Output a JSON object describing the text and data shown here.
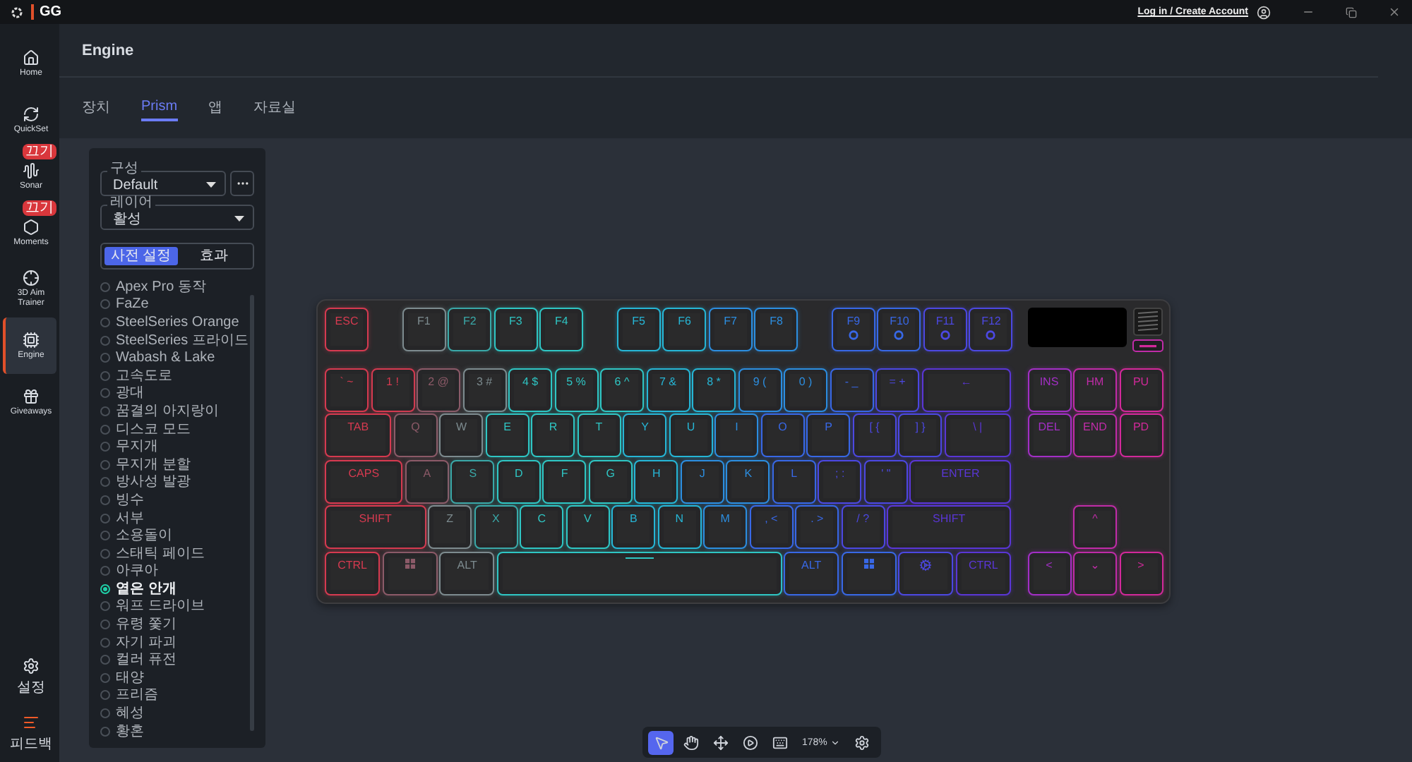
{
  "top_bar": {
    "logo": "GG",
    "account_link": "Log in / Create Account"
  },
  "sidebar": {
    "items": [
      {
        "kind": "home",
        "label": "Home",
        "selected": false
      },
      {
        "kind": "quickset",
        "label": "QuickSet",
        "selected": false
      },
      {
        "kind": "sonar",
        "label": "Sonar",
        "badge": "끄기",
        "selected": false
      },
      {
        "kind": "moments",
        "label": "Moments",
        "badge": "끄기",
        "selected": false
      },
      {
        "kind": "aim",
        "label": "3D Aim Trainer",
        "selected": false
      },
      {
        "kind": "engine",
        "label": "Engine",
        "selected": true
      },
      {
        "kind": "giveaways",
        "label": "Giveaways",
        "selected": false
      }
    ],
    "bottom_items": [
      {
        "kind": "settings",
        "label": "설정"
      },
      {
        "kind": "feedback",
        "label": "피드백"
      }
    ]
  },
  "page": {
    "title": "Engine",
    "tabs": [
      {
        "label": "장치",
        "selected": false
      },
      {
        "label": "Prism",
        "selected": true
      },
      {
        "label": "앱",
        "selected": false
      },
      {
        "label": "자료실",
        "selected": false
      }
    ]
  },
  "panel": {
    "config": {
      "label": "구성",
      "value": "Default"
    },
    "layer": {
      "label": "레이어",
      "value": "활성"
    },
    "modes": [
      {
        "label": "사전 설정",
        "selected": true
      },
      {
        "label": "효과",
        "selected": false
      }
    ],
    "presets": [
      {
        "label": "Apex Pro 동작",
        "selected": false
      },
      {
        "label": "FaZe",
        "selected": false
      },
      {
        "label": "SteelSeries Orange",
        "selected": false
      },
      {
        "label": "SteelSeries 프라이드",
        "selected": false
      },
      {
        "label": "Wabash & Lake",
        "selected": false
      },
      {
        "label": "고속도로",
        "selected": false
      },
      {
        "label": "광대",
        "selected": false
      },
      {
        "label": "꿈결의 아지랑이",
        "selected": false
      },
      {
        "label": "디스코 모드",
        "selected": false
      },
      {
        "label": "무지개",
        "selected": false
      },
      {
        "label": "무지개 분할",
        "selected": false
      },
      {
        "label": "방사성 발광",
        "selected": false
      },
      {
        "label": "빙수",
        "selected": false
      },
      {
        "label": "서부",
        "selected": false
      },
      {
        "label": "소용돌이",
        "selected": false
      },
      {
        "label": "스태틱 페이드",
        "selected": false
      },
      {
        "label": "아쿠아",
        "selected": false
      },
      {
        "label": "옅은 안개",
        "selected": true
      },
      {
        "label": "워프 드라이브",
        "selected": false
      },
      {
        "label": "유령 쫓기",
        "selected": false
      },
      {
        "label": "자기 파괴",
        "selected": false
      },
      {
        "label": "컬러 퓨전",
        "selected": false
      },
      {
        "label": "태양",
        "selected": false
      },
      {
        "label": "프리즘",
        "selected": false
      },
      {
        "label": "혜성",
        "selected": false
      },
      {
        "label": "황혼",
        "selected": false
      }
    ]
  },
  "keyboard": {
    "function_row": [
      [
        {
          "kind": "key",
          "label": "ESC",
          "color": "#d63a50"
        }
      ],
      [
        {
          "kind": "key",
          "label": "F1",
          "color": "#7d8b8f"
        },
        {
          "kind": "key",
          "label": "F2",
          "color": "#3aa8a8"
        },
        {
          "kind": "key",
          "label": "F3",
          "color": "#2fc6c4"
        },
        {
          "kind": "key",
          "label": "F4",
          "color": "#2fc6c4"
        }
      ],
      [
        {
          "kind": "key",
          "label": "F5",
          "color": "#26b6d6"
        },
        {
          "kind": "key",
          "label": "F6",
          "color": "#26b6d6"
        },
        {
          "kind": "key",
          "label": "F7",
          "color": "#2c8ee0"
        },
        {
          "kind": "key",
          "label": "F8",
          "color": "#2c8ee0"
        }
      ],
      [
        {
          "kind": "media",
          "label": "F9",
          "color": "#3868e6"
        },
        {
          "kind": "media",
          "label": "F10",
          "color": "#3868e6"
        },
        {
          "kind": "media",
          "label": "F11",
          "color": "#4c48e2"
        },
        {
          "kind": "media",
          "label": "F12",
          "color": "#4c48e2"
        }
      ]
    ],
    "main_rows": [
      [
        {
          "kind": "key",
          "label": "` ~",
          "color": "#d63a50"
        },
        {
          "kind": "key",
          "label": "1 !",
          "color": "#d63a50"
        },
        {
          "kind": "key",
          "label": "2 @",
          "color": "#8c5a68"
        },
        {
          "kind": "key",
          "label": "3 #",
          "color": "#7d8b8f"
        },
        {
          "kind": "key",
          "label": "4 $",
          "color": "#2fc6c4"
        },
        {
          "kind": "key",
          "label": "5 %",
          "color": "#2fc6c4"
        },
        {
          "kind": "key",
          "label": "6 ^",
          "color": "#2fc6c4"
        },
        {
          "kind": "key",
          "label": "7 &",
          "color": "#26b6d6"
        },
        {
          "kind": "key",
          "label": "8 *",
          "color": "#26b6d6"
        },
        {
          "kind": "key",
          "label": "9 (",
          "color": "#2c8ee0"
        },
        {
          "kind": "key",
          "label": "0 )",
          "color": "#2c8ee0"
        },
        {
          "kind": "key",
          "label": "- _",
          "color": "#3868e6"
        },
        {
          "kind": "key",
          "label": "= +",
          "color": "#4c48e2"
        },
        {
          "kind": "back",
          "label": "←",
          "color": "#5a36d6"
        }
      ],
      [
        {
          "kind": "tab",
          "label": "TAB",
          "color": "#d63a50"
        },
        {
          "kind": "key",
          "label": "Q",
          "color": "#8c5a68"
        },
        {
          "kind": "key",
          "label": "W",
          "color": "#7d8b8f"
        },
        {
          "kind": "key",
          "label": "E",
          "color": "#2fc6c4"
        },
        {
          "kind": "key",
          "label": "R",
          "color": "#2fc6c4"
        },
        {
          "kind": "key",
          "label": "T",
          "color": "#2fc6c4"
        },
        {
          "kind": "key",
          "label": "Y",
          "color": "#26b6d6"
        },
        {
          "kind": "key",
          "label": "U",
          "color": "#26b6d6"
        },
        {
          "kind": "key",
          "label": "I",
          "color": "#2c8ee0"
        },
        {
          "kind": "key",
          "label": "O",
          "color": "#3868e6"
        },
        {
          "kind": "key",
          "label": "P",
          "color": "#3868e6"
        },
        {
          "kind": "key",
          "label": "[ {",
          "color": "#4c48e2"
        },
        {
          "kind": "key",
          "label": "] }",
          "color": "#4c48e2"
        },
        {
          "kind": "tab",
          "label": "\\ |",
          "color": "#5a36d6"
        }
      ],
      [
        {
          "kind": "caps",
          "label": "CAPS",
          "color": "#d63a50"
        },
        {
          "kind": "key",
          "label": "A",
          "color": "#8c5a68"
        },
        {
          "kind": "key",
          "label": "S",
          "color": "#3aa8a8"
        },
        {
          "kind": "key",
          "label": "D",
          "color": "#2fc6c4"
        },
        {
          "kind": "key",
          "label": "F",
          "color": "#2fc6c4"
        },
        {
          "kind": "key",
          "label": "G",
          "color": "#2fc6c4"
        },
        {
          "kind": "key",
          "label": "H",
          "color": "#26b6d6"
        },
        {
          "kind": "key",
          "label": "J",
          "color": "#2c8ee0"
        },
        {
          "kind": "key",
          "label": "K",
          "color": "#2c8ee0"
        },
        {
          "kind": "key",
          "label": "L",
          "color": "#3868e6"
        },
        {
          "kind": "key",
          "label": "; :",
          "color": "#4c48e2"
        },
        {
          "kind": "key",
          "label": "' \"",
          "color": "#4c48e2"
        },
        {
          "kind": "enter",
          "label": "ENTER",
          "color": "#5a36d6"
        }
      ],
      [
        {
          "kind": "shift",
          "label": "SHIFT",
          "color": "#d63a50"
        },
        {
          "kind": "key",
          "label": "Z",
          "color": "#7d8b8f"
        },
        {
          "kind": "key",
          "label": "X",
          "color": "#3aa8a8"
        },
        {
          "kind": "key",
          "label": "C",
          "color": "#2fc6c4"
        },
        {
          "kind": "key",
          "label": "V",
          "color": "#2fc6c4"
        },
        {
          "kind": "key",
          "label": "B",
          "color": "#26b6d6"
        },
        {
          "kind": "key",
          "label": "N",
          "color": "#26b6d6"
        },
        {
          "kind": "key",
          "label": "M",
          "color": "#2c8ee0"
        },
        {
          "kind": "key",
          "label": ", <",
          "color": "#3868e6"
        },
        {
          "kind": "key",
          "label": ". >",
          "color": "#3868e6"
        },
        {
          "kind": "key",
          "label": "/ ?",
          "color": "#4c48e2"
        },
        {
          "kind": "rshift",
          "label": "SHIFT",
          "color": "#5a36d6"
        }
      ],
      [
        {
          "kind": "mod",
          "label": "CTRL",
          "color": "#d63a50"
        },
        {
          "kind": "win",
          "color": "#8c5a68"
        },
        {
          "kind": "mod",
          "label": "ALT",
          "color": "#7d8b8f"
        },
        {
          "kind": "space",
          "color": "#2fc6c4"
        },
        {
          "kind": "mod",
          "label": "ALT",
          "color": "#3868e6"
        },
        {
          "kind": "win",
          "color": "#3868e6"
        },
        {
          "kind": "logo",
          "color": "#4c48e2"
        },
        {
          "kind": "mod",
          "label": "CTRL",
          "color": "#5a36d6"
        }
      ]
    ],
    "nav_rows": [
      [
        {
          "kind": "key",
          "label": "INS",
          "color": "#a32fc6"
        },
        {
          "kind": "key",
          "label": "HM",
          "color": "#c02ca8"
        },
        {
          "kind": "key",
          "label": "PU",
          "color": "#d2299a"
        }
      ],
      [
        {
          "kind": "key",
          "label": "DEL",
          "color": "#a32fc6"
        },
        {
          "kind": "key",
          "label": "END",
          "color": "#c02ca8"
        },
        {
          "kind": "key",
          "label": "PD",
          "color": "#d2299a"
        }
      ],
      [],
      [
        {
          "kind": "blank"
        },
        {
          "kind": "key",
          "label": "^",
          "color": "#c02ca8"
        },
        {
          "kind": "blank"
        }
      ],
      [
        {
          "kind": "key",
          "label": "<",
          "color": "#a32fc6"
        },
        {
          "kind": "key",
          "label": "⌄",
          "color": "#c02ca8"
        },
        {
          "kind": "key",
          "label": ">",
          "color": "#d2299a"
        }
      ]
    ]
  },
  "toolbar": {
    "tools": [
      {
        "kind": "pointer",
        "selected": true
      },
      {
        "kind": "hand",
        "selected": false
      },
      {
        "kind": "move",
        "selected": false
      },
      {
        "kind": "replay",
        "selected": false
      },
      {
        "kind": "keyboard",
        "selected": false
      }
    ],
    "zoom": "178%"
  }
}
